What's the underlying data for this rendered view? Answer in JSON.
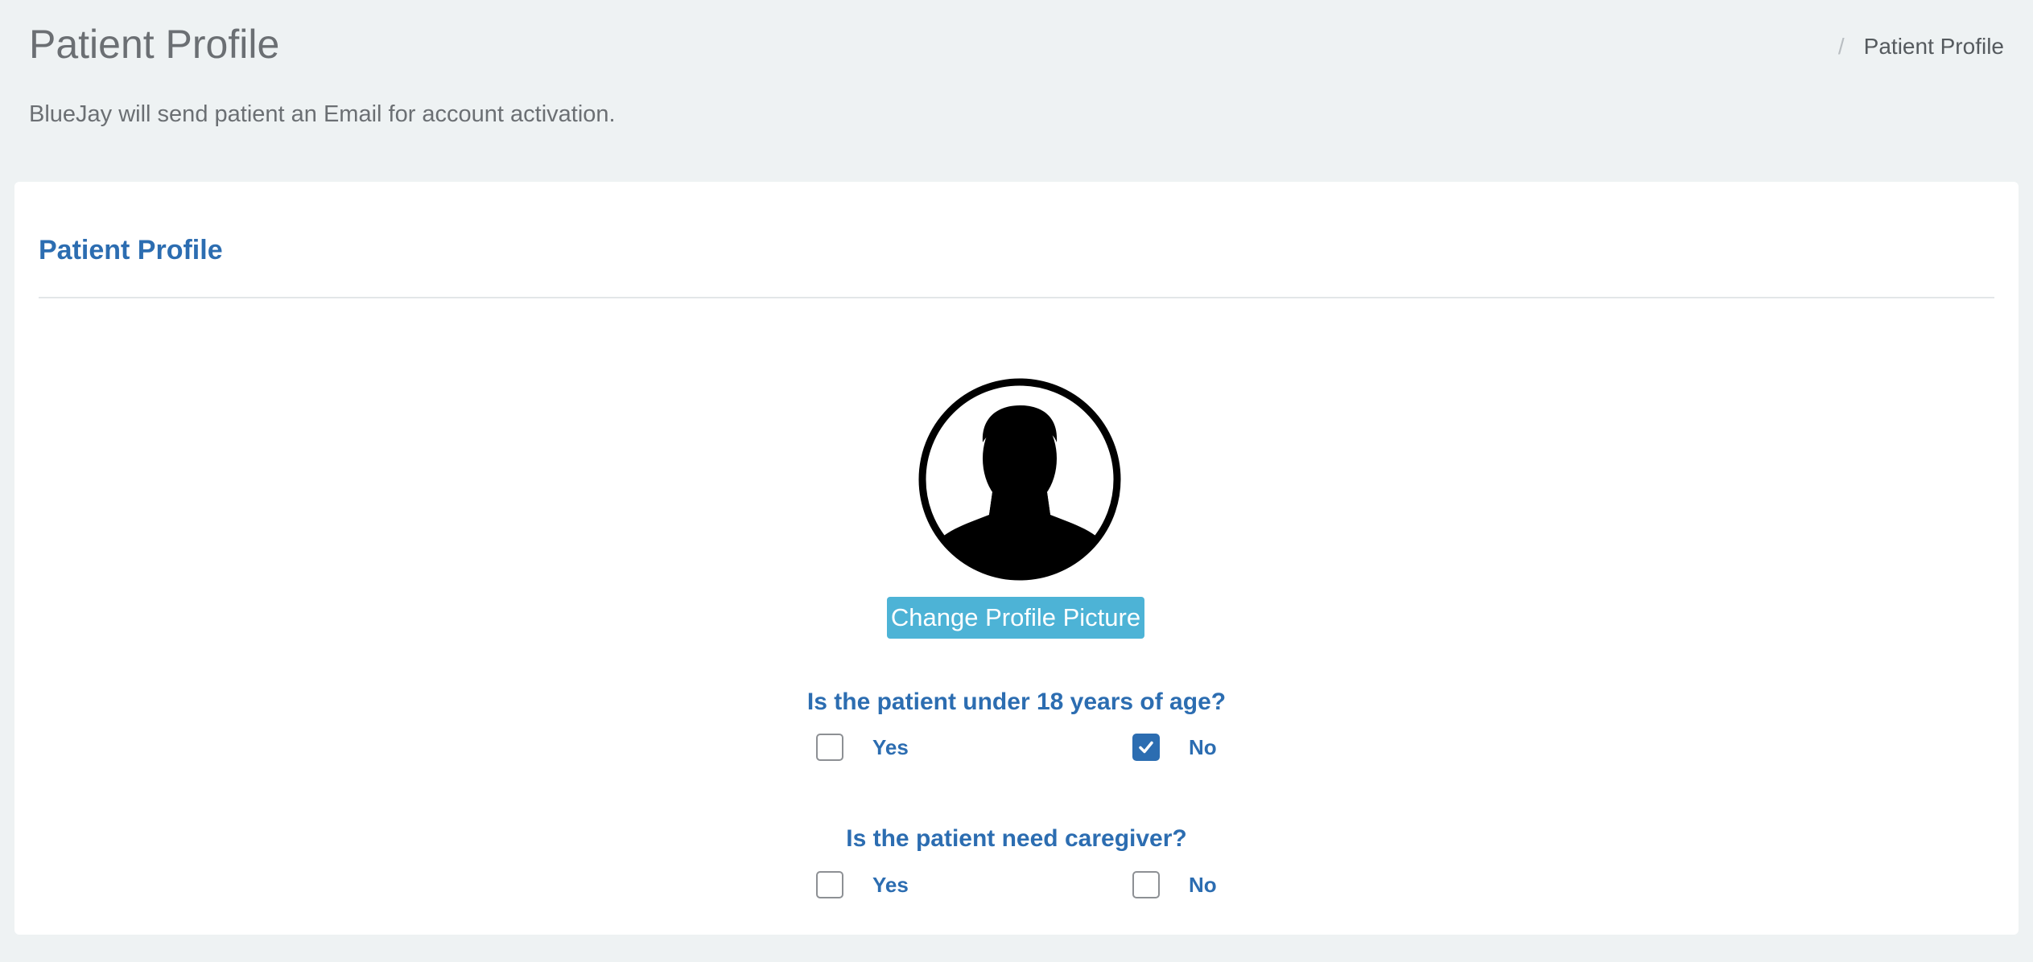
{
  "header": {
    "title": "Patient Profile",
    "breadcrumb_separator": "/",
    "breadcrumb_current": "Patient Profile",
    "subtitle": "BlueJay will send patient an Email for account activation."
  },
  "card": {
    "title": "Patient Profile",
    "avatar_icon": "user-silhouette-icon",
    "change_picture_label": "Change Profile Picture"
  },
  "questions": [
    {
      "text": "Is the patient under 18 years of age?",
      "options": [
        {
          "label": "Yes",
          "checked": false
        },
        {
          "label": "No",
          "checked": true
        }
      ]
    },
    {
      "text": "Is the patient need caregiver?",
      "options": [
        {
          "label": "Yes",
          "checked": false
        },
        {
          "label": "No",
          "checked": false
        }
      ]
    }
  ],
  "colors": {
    "accent": "#2c6db1",
    "button": "#4db3d6",
    "background": "#eef2f3",
    "muted_text": "#6b6f73"
  }
}
